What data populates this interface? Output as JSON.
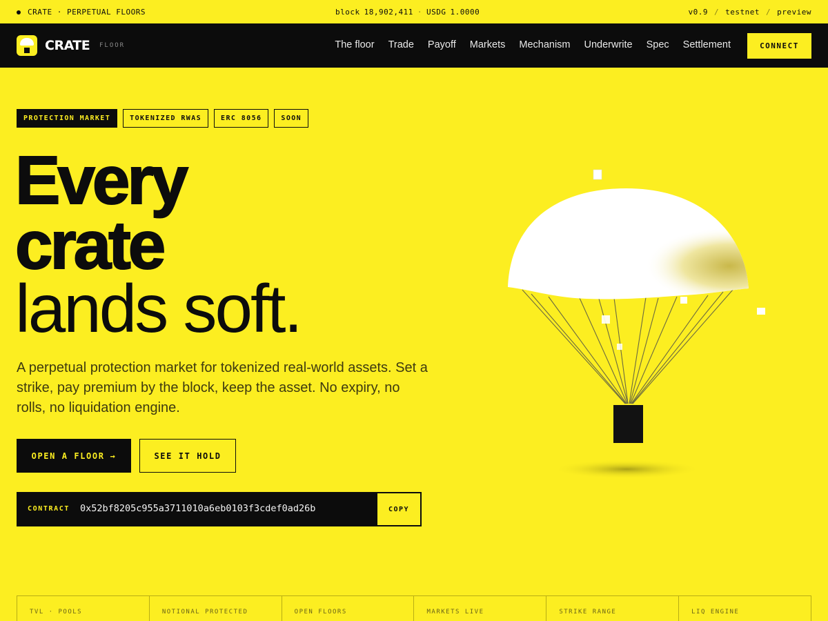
{
  "ticker": {
    "left": "CRATE · PERPETUAL FLOORS",
    "block_label": "block",
    "block_value": "18,902,411",
    "sep": "·",
    "usdg_label": "USDG",
    "usdg_value": "1.0000",
    "version": "v0.9",
    "slash": "/",
    "network": "testnet",
    "mode": "preview"
  },
  "nav": {
    "brand": "CRATE",
    "brand_sub": "FLOOR",
    "links": [
      "The floor",
      "Trade",
      "Payoff",
      "Markets",
      "Mechanism",
      "Underwrite",
      "Spec",
      "Settlement"
    ],
    "connect": "CONNECT"
  },
  "hero": {
    "tags": [
      "PROTECTION MARKET",
      "TOKENIZED RWAS",
      "ERC 8056",
      "SOON"
    ],
    "title_line1": "Every",
    "title_line2": "crate",
    "title_line3": "lands soft.",
    "lede": "A perpetual protection market for tokenized real-world assets. Set a strike, pay premium by the block, keep the asset. No expiry, no rolls, no liquidation engine.",
    "primary_cta": "OPEN A FLOOR",
    "primary_cta_arrow": "→",
    "secondary_cta": "SEE IT HOLD",
    "contract_label": "CONTRACT",
    "contract_address": "0x52bf8205c955a3711010a6eb0103f3cdef0ad26b",
    "copy": "COPY"
  },
  "stats": [
    "TVL · POOLS",
    "NOTIONAL PROTECTED",
    "OPEN FLOORS",
    "MARKETS LIVE",
    "STRIKE RANGE",
    "LIQ ENGINE"
  ],
  "colors": {
    "accent": "#fcee21",
    "ink": "#0c0c0c"
  }
}
